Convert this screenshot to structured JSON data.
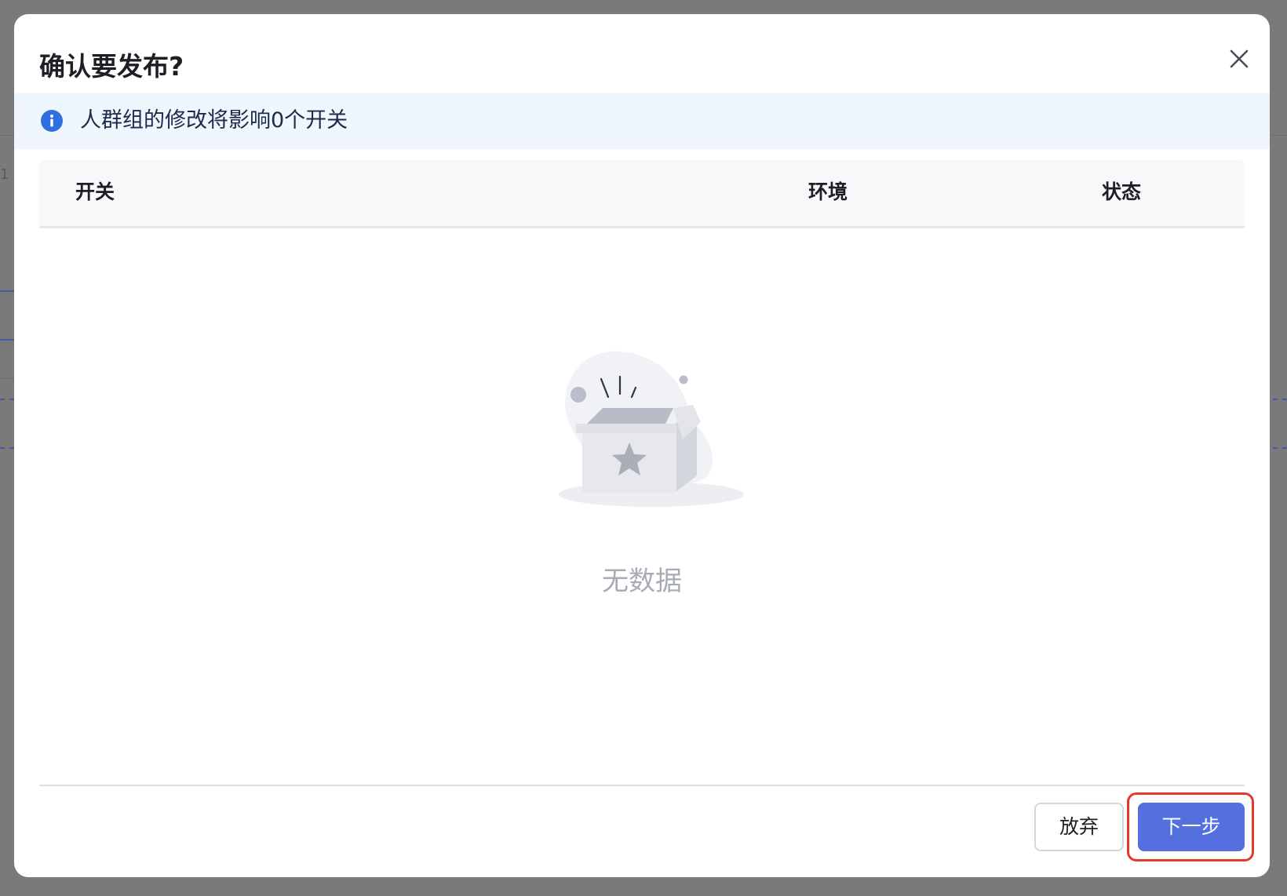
{
  "background": {
    "row_number": "1"
  },
  "modal": {
    "title": "确认要发布?",
    "close_icon": "close-icon"
  },
  "alert": {
    "icon": "info-icon",
    "text": "人群组的修改将影响0个开关"
  },
  "table": {
    "columns": [
      "开关",
      "环境",
      "状态"
    ],
    "rows": [],
    "empty_text": "无数据",
    "empty_icon": "empty-box-icon"
  },
  "footer": {
    "cancel_label": "放弃",
    "next_label": "下一步"
  },
  "colors": {
    "primary": "#5470df",
    "highlight": "#e23a2a",
    "info": "#2f6fe0"
  }
}
